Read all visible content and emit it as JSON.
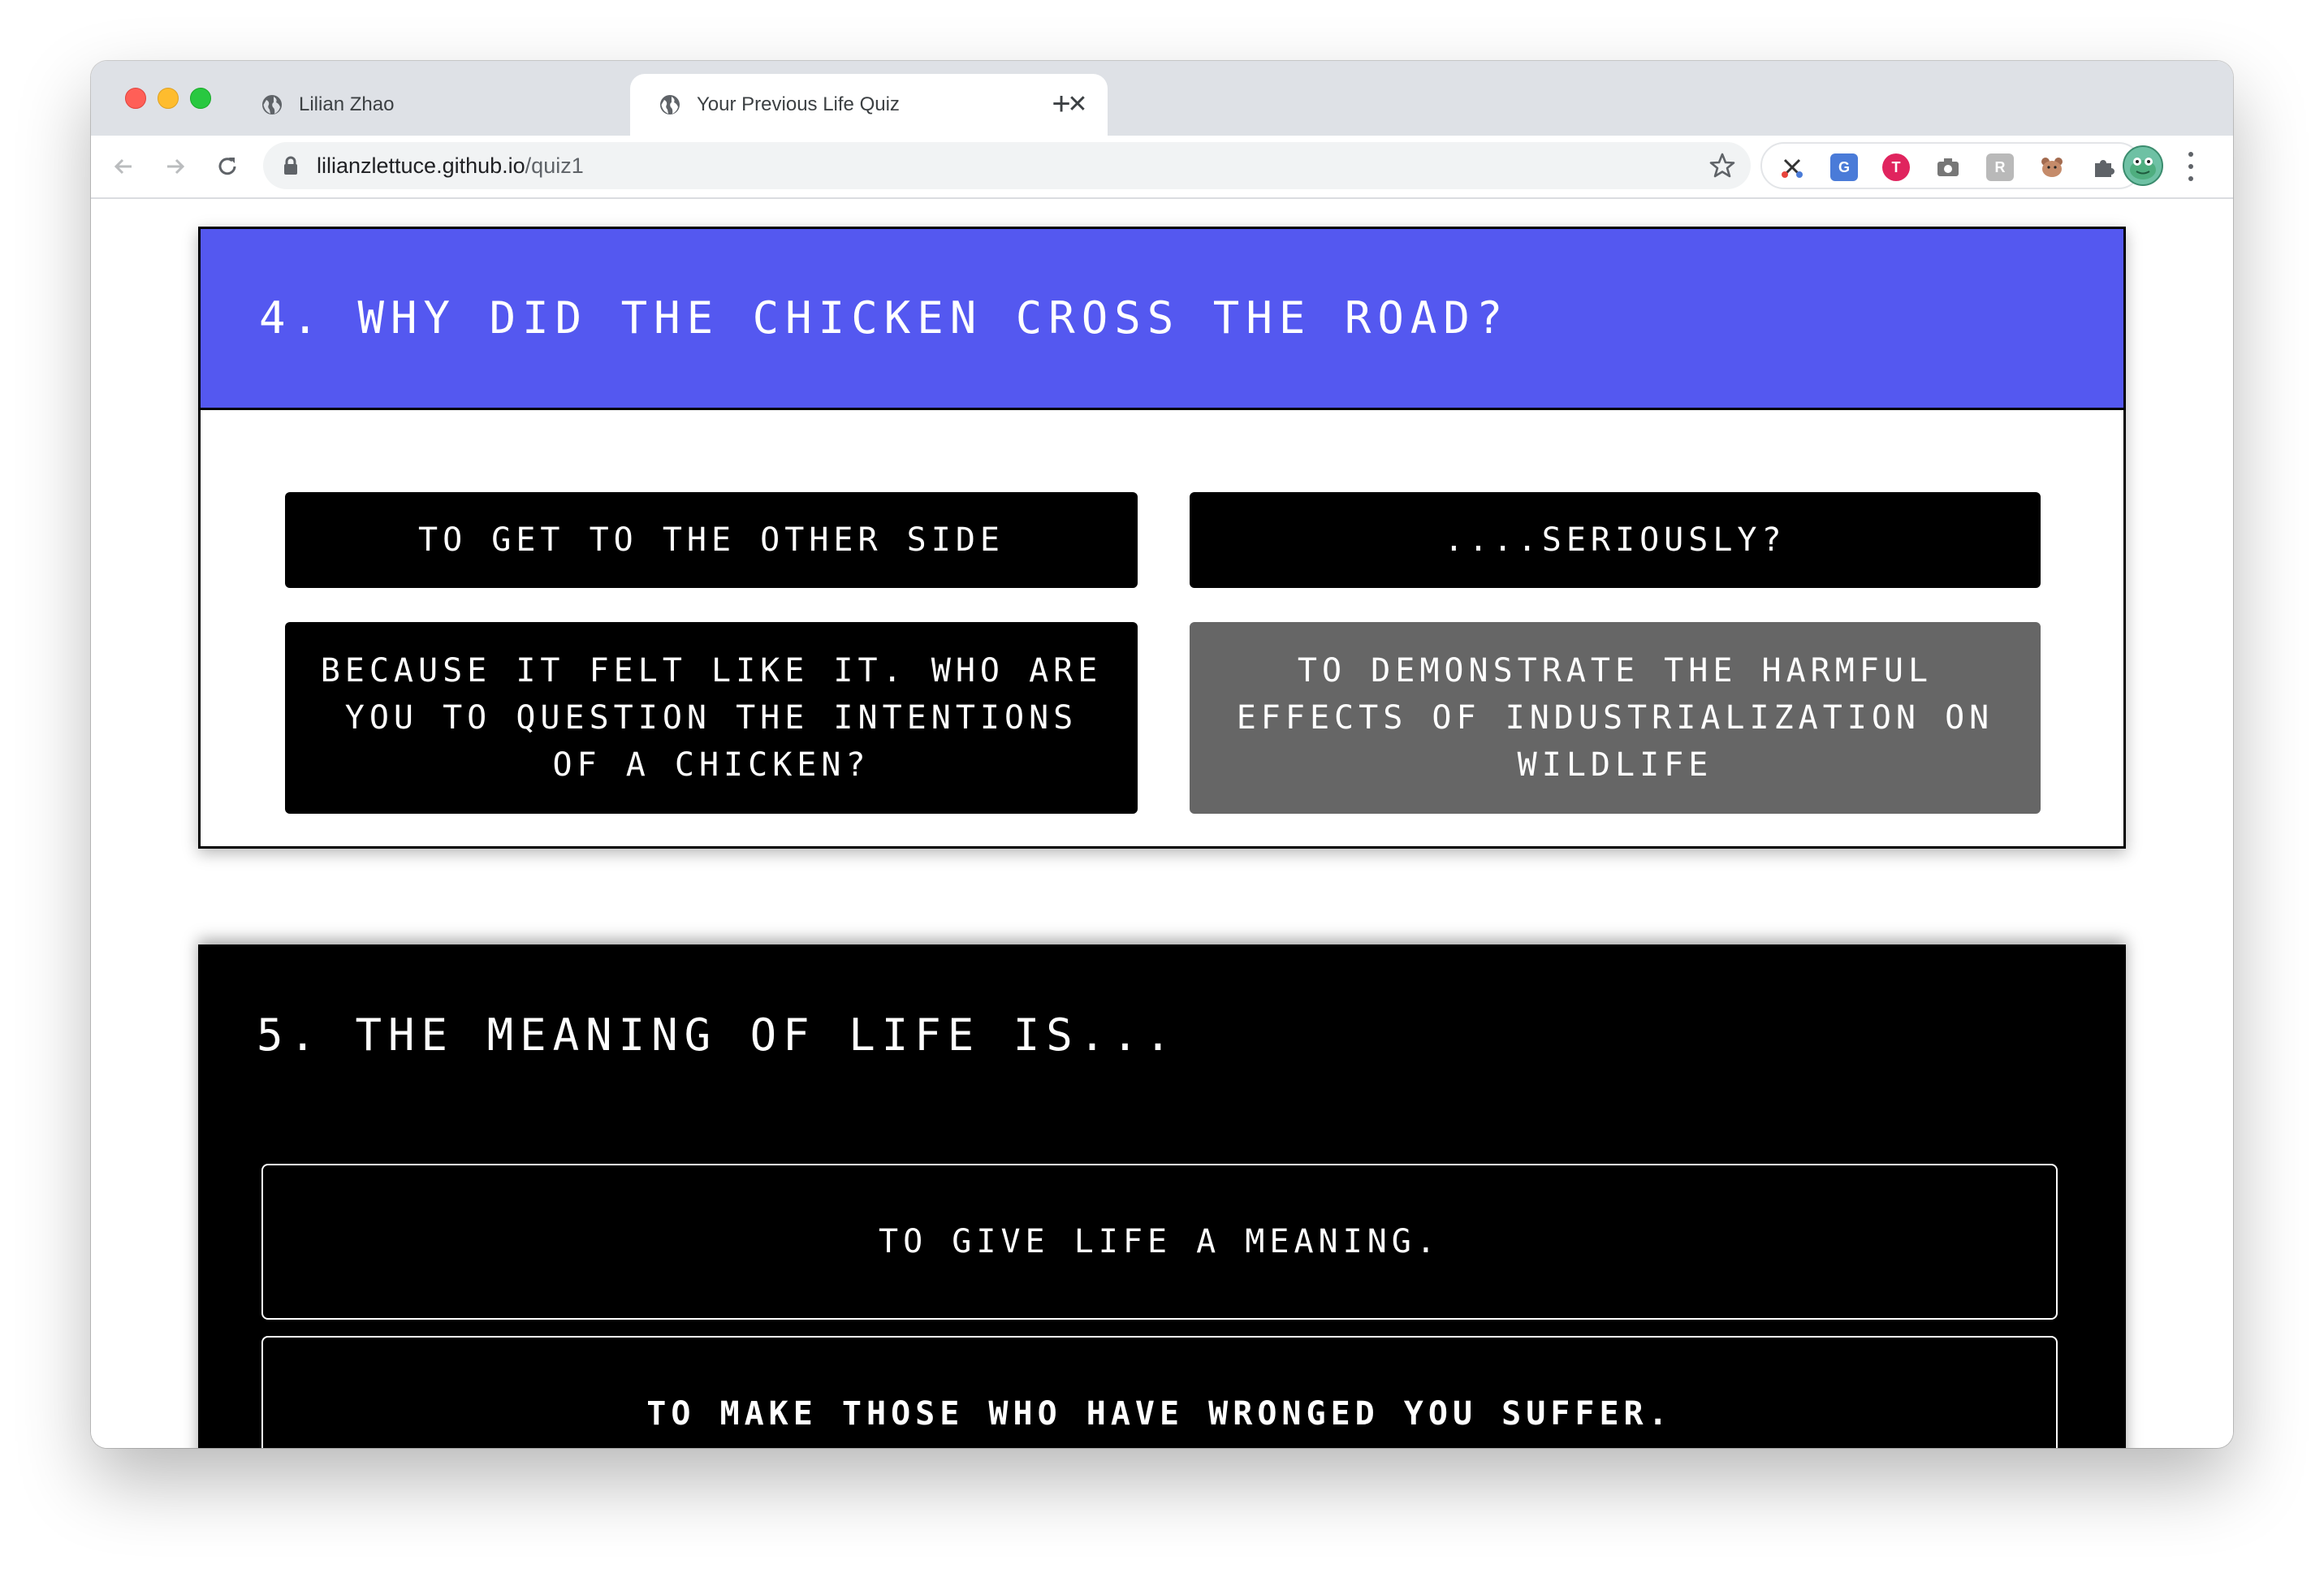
{
  "browser": {
    "tabs": [
      {
        "title": "Lilian Zhao",
        "close": "✕",
        "active": false
      },
      {
        "title": "Your Previous Life Quiz",
        "close": "✕",
        "active": true
      }
    ],
    "new_tab": "+",
    "url_host": "lilianzlettuce.github.io",
    "url_path": "/quiz1",
    "extensions": [
      "scissors-icon",
      "translate-icon",
      "red-circle-icon",
      "camera-icon",
      "gray-box-icon",
      "bear-icon",
      "puzzle-icon"
    ],
    "profile_avatar": "avatar-icon"
  },
  "quiz": {
    "q4": {
      "title": "4. Why did the chicken cross the road?",
      "header_color": "#5458f0",
      "options": [
        {
          "label": "To get to the other side",
          "style": "black"
        },
        {
          "label": "....Seriously?",
          "style": "black"
        },
        {
          "label": "Because it felt like it. Who are you to question the intentions of a chicken?",
          "style": "black"
        },
        {
          "label": "To demonstrate the harmful effects of industrialization on wildlife",
          "style": "grey"
        }
      ]
    },
    "q5": {
      "title": "5. The meaning of life is...",
      "options": [
        {
          "label": "To give life a meaning."
        },
        {
          "label": "To make those who have wronged you suffer."
        }
      ]
    }
  }
}
